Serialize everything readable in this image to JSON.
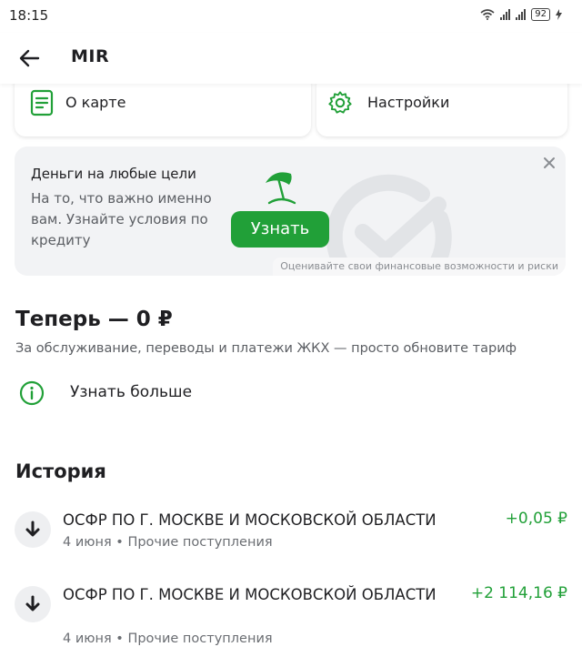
{
  "status_bar": {
    "time": "18:15",
    "battery": "92"
  },
  "header": {
    "title": "MIR"
  },
  "cards": {
    "about_label": "О карте",
    "settings_label": "Настройки"
  },
  "promo": {
    "title": "Деньги на любые цели",
    "text": "На то, что важно именно вам. Узнайте условия по кредиту",
    "button_label": "Узнать",
    "disclaimer": "Оценивайте свои финансовые возможности и риски"
  },
  "tariff": {
    "title": "Теперь — 0 ₽",
    "subtitle": "За обслуживание, переводы и платежи ЖКХ — просто обновите тариф",
    "link_label": "Узнать больше"
  },
  "history": {
    "title": "История",
    "transactions": [
      {
        "name": "ОСФР ПО Г. МОСКВЕ И МОСКОВСКОЙ ОБЛАСТИ",
        "meta": "4 июня • Прочие поступления",
        "amount": "+0,05 ₽"
      },
      {
        "name": "ОСФР ПО Г. МОСКВЕ И МОСКОВСКОЙ ОБЛАСТИ",
        "meta": "4 июня • Прочие поступления",
        "amount": "+2 114,16 ₽"
      }
    ]
  },
  "colors": {
    "accent": "#21a038",
    "banner_bg": "#f2f3f5"
  }
}
